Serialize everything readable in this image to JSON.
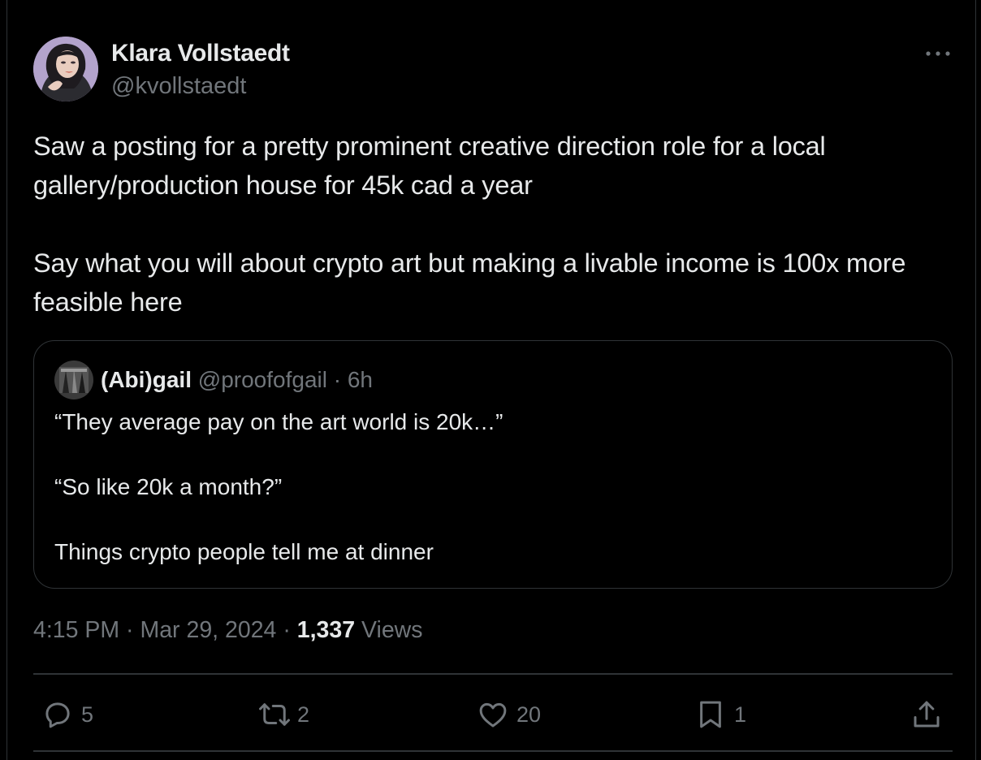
{
  "tweet": {
    "author": {
      "name": "Klara Vollstaedt",
      "handle": "@kvollstaedt"
    },
    "paragraphs": [
      "Saw a posting for a pretty prominent creative direction role for a local gallery/production house for 45k cad a year",
      "Say what you will about crypto art but making a livable income is 100x more feasible here"
    ],
    "quote": {
      "name": "(Abi)gail",
      "handle": "@proofofgail",
      "separator": " · ",
      "age": "6h",
      "paragraphs": [
        "“They average pay on the art world is 20k…”",
        "“So like 20k a month?”",
        "Things crypto people tell me at dinner"
      ]
    },
    "meta": {
      "time": "4:15 PM",
      "separator": " · ",
      "date": "Mar 29, 2024",
      "views_count": "1,337",
      "views_label": "Views"
    },
    "actions": {
      "replies": "5",
      "reposts": "2",
      "likes": "20",
      "bookmarks": "1"
    }
  },
  "icons": {
    "more": "more-horizontal-icon",
    "reply": "reply-icon",
    "repost": "repost-icon",
    "like": "heart-icon",
    "bookmark": "bookmark-icon",
    "share": "share-icon"
  },
  "colors": {
    "background": "#000000",
    "text_primary": "#e7e9ea",
    "text_secondary": "#71767b",
    "border": "#2f3336"
  }
}
